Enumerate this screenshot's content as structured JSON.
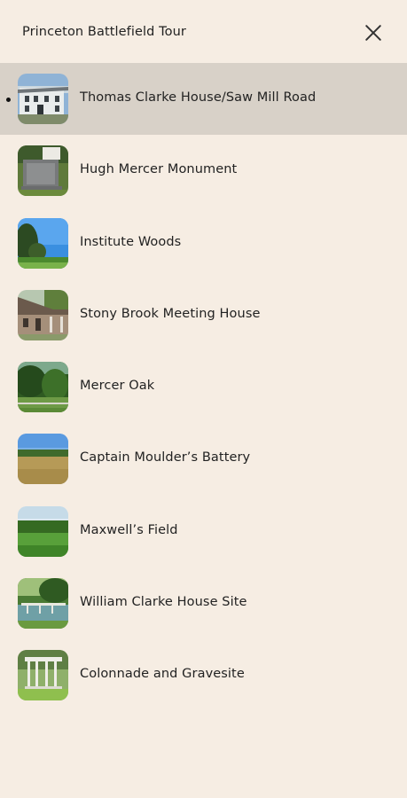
{
  "header": {
    "title": "Princeton Battlefield Tour"
  },
  "close_icon": "close-icon",
  "stops": [
    {
      "label": "Thomas Clarke House/Saw Mill Road",
      "active": true,
      "image": "white-house-photo"
    },
    {
      "label": "Hugh Mercer Monument",
      "active": false,
      "image": "stone-monument-photo"
    },
    {
      "label": "Institute Woods",
      "active": false,
      "image": "woods-photo"
    },
    {
      "label": "Stony Brook Meeting House",
      "active": false,
      "image": "stone-meeting-house-photo"
    },
    {
      "label": "Mercer Oak",
      "active": false,
      "image": "oak-tree-photo"
    },
    {
      "label": "Captain Moulder’s Battery",
      "active": false,
      "image": "field-photo"
    },
    {
      "label": "Maxwell’s Field",
      "active": false,
      "image": "green-field-photo"
    },
    {
      "label": "William Clarke House Site",
      "active": false,
      "image": "bridge-creek-photo"
    },
    {
      "label": "Colonnade and Gravesite",
      "active": false,
      "image": "colonnade-photo"
    }
  ],
  "colors": {
    "background": "#f6ede3",
    "active_row": "#d8d1c8",
    "text": "#222222"
  }
}
